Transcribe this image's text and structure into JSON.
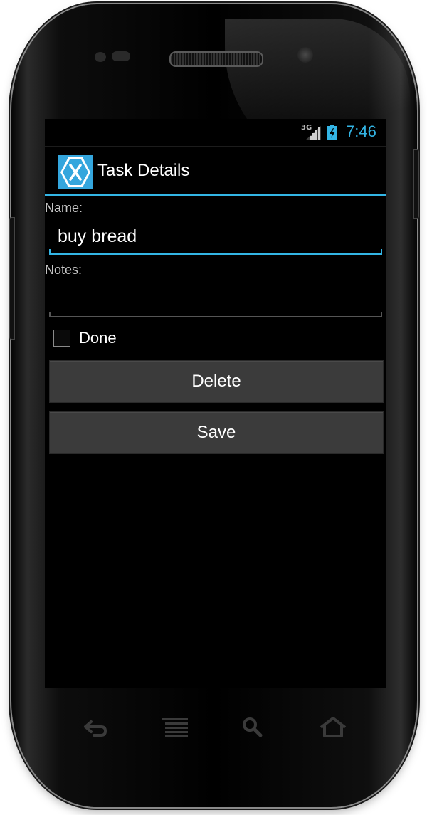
{
  "status_bar": {
    "network": "3G",
    "time": "7:46",
    "signal_icon": "signal-icon",
    "battery_icon": "battery-charging-icon"
  },
  "action_bar": {
    "app_icon": "xamarin-logo-icon",
    "title": "Task Details"
  },
  "form": {
    "name_label": "Name:",
    "name_value": "buy bread",
    "notes_label": "Notes:",
    "notes_value": "",
    "done_label": "Done",
    "done_checked": false
  },
  "buttons": {
    "delete_label": "Delete",
    "save_label": "Save"
  },
  "nav_keys": [
    "back-icon",
    "menu-icon",
    "search-icon",
    "home-icon"
  ],
  "colors": {
    "accent": "#33b5e5",
    "button_bg": "#3b3b3b",
    "screen_bg": "#000000"
  }
}
